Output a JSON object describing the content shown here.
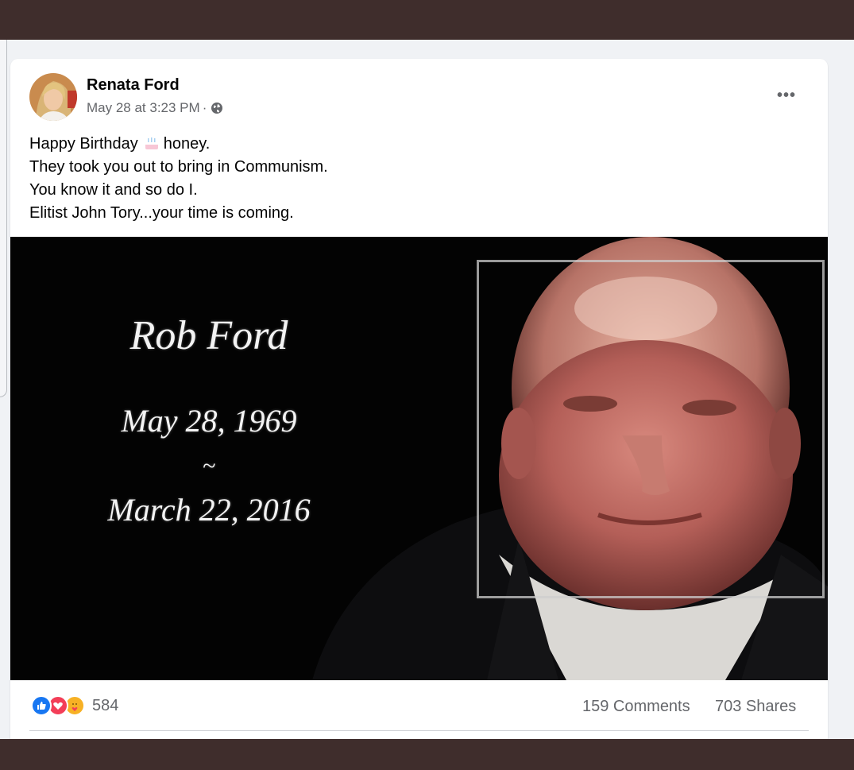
{
  "post": {
    "author": "Renata Ford",
    "timestamp": "May 28 at 3:23 PM",
    "separator": "·",
    "privacy_icon": "globe-icon",
    "more_label": "•••",
    "text_lines": [
      "Happy Birthday",
      "honey.",
      "They took you out to bring in Communism.",
      "You know it and so do I.",
      "Elitist John Tory...your time is coming."
    ],
    "emoji": "birthday-cake-icon"
  },
  "image": {
    "name": "Rob Ford",
    "birth": "May 28, 1969",
    "tilde": "~",
    "death": "March 22, 2016"
  },
  "engagement": {
    "reactions": [
      "like-icon",
      "love-icon",
      "care-icon"
    ],
    "reaction_count": "584",
    "comments": "159 Comments",
    "shares": "703 Shares"
  },
  "colors": {
    "outer_background": "#3f2d2c",
    "feed_background": "#f0f2f5",
    "like_blue": "#1877f2",
    "love_red": "#f33e58",
    "secondary_text": "#65676b"
  }
}
